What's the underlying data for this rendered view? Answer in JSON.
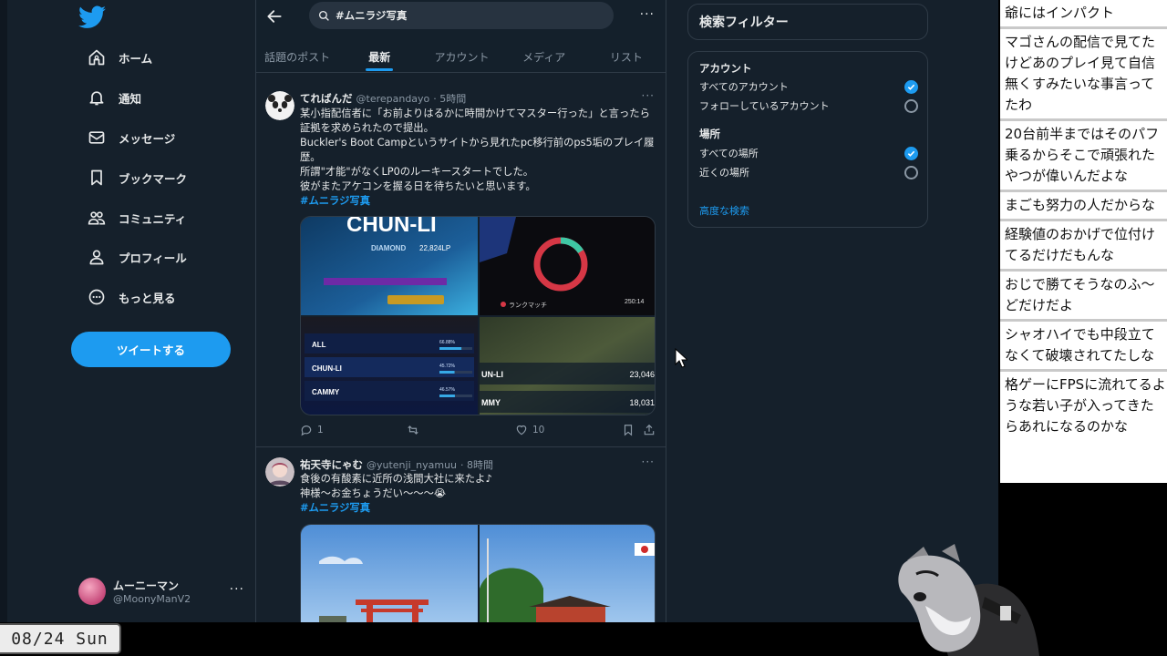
{
  "nav": {
    "items": [
      {
        "label": "ホーム",
        "icon": "home-icon"
      },
      {
        "label": "通知",
        "icon": "bell-icon"
      },
      {
        "label": "メッセージ",
        "icon": "mail-icon"
      },
      {
        "label": "ブックマーク",
        "icon": "bookmark-icon"
      },
      {
        "label": "コミュニティ",
        "icon": "community-icon"
      },
      {
        "label": "プロフィール",
        "icon": "person-icon"
      },
      {
        "label": "もっと見る",
        "icon": "more-circle-icon"
      }
    ],
    "tweet_button": "ツイートする",
    "profile": {
      "name": "ムーニーマン",
      "handle": "@MoonyManV2"
    }
  },
  "search": {
    "query": "#ムニラジ写真"
  },
  "tabs": [
    "話題のポスト",
    "最新",
    "アカウント",
    "メディア",
    "リスト"
  ],
  "active_tab": "最新",
  "tweets": [
    {
      "name": "てればんだ",
      "handle": "@terepandayo",
      "time": "· 5時間",
      "lines": [
        "某小指配信者に「お前よりはるかに時間かけてマスター行った」と言ったら",
        "証拠を求められたので提出。",
        "Buckler's Boot Campというサイトから見れたpc移行前のps5垢のプレイ履",
        "歴。",
        "所謂\"才能\"がなくLP0のルーキースタートでした。",
        "彼がまたアケコンを握る日を待ちたいと思います。"
      ],
      "hashtag": "#ムニラジ写真",
      "media": {
        "title": "CHUN-LI",
        "rank": "DIAMOND",
        "league_points": "22,824LP",
        "match_label": "ランクマッチ",
        "time_value": "250:14",
        "rows": [
          {
            "name": "ALL",
            "pct": "66.88%",
            "fill": 0.67
          },
          {
            "name": "CHUN-LI",
            "pct": "45.72%",
            "fill": 0.46
          },
          {
            "name": "CAMMY",
            "pct": "46.57%",
            "fill": 0.47
          }
        ],
        "right_rows": [
          {
            "name": "UN-LI",
            "value": "23,046"
          },
          {
            "name": "MMY",
            "value": "18,031"
          }
        ]
      },
      "replies": "1",
      "likes": "10"
    },
    {
      "name": "祐天寺にゃむ",
      "handle": "@yutenji_nyamuu",
      "time": "· 8時間",
      "lines": [
        "食後の有酸素に近所の浅間大社に来たよ♪",
        "神様〜お金ちょうだい〜〜〜😭"
      ],
      "hashtag": "#ムニラジ写真"
    }
  ],
  "filters": {
    "title": "検索フィルター",
    "account_heading": "アカウント",
    "account_options": [
      {
        "label": "すべてのアカウント",
        "checked": true
      },
      {
        "label": "フォローしているアカウント",
        "checked": false
      }
    ],
    "location_heading": "場所",
    "location_options": [
      {
        "label": "すべての場所",
        "checked": true
      },
      {
        "label": "近くの場所",
        "checked": false
      }
    ],
    "advanced": "高度な検索"
  },
  "comments": [
    [
      "爺にはインパクト"
    ],
    [
      "マゴさんの配信で見てた",
      "けどあのプレイ見て自信",
      "無くすみたいな事言って",
      "たわ"
    ],
    [
      "20台前半まではそのパフ",
      "乗るからそこで頑張れた",
      "やつが偉いんだよな"
    ],
    [
      "まごも努力の人だからな"
    ],
    [
      "経験値のおかげで位付け",
      "てるだけだもんな"
    ],
    [
      "おじで勝てそうなのふ〜",
      "どだけだよ"
    ],
    [
      "シャオハイでも中段立て",
      "なくて破壊されてたしな"
    ],
    [
      "格ゲーにFPSに流れてるよ",
      "うな若い子が入ってきた",
      "らあれになるのかな"
    ]
  ],
  "date": "08/24 Sun",
  "colors": {
    "accent": "#1d9bf0",
    "background": "#15202b",
    "border": "#2f3b47",
    "muted": "#8b98a5"
  }
}
